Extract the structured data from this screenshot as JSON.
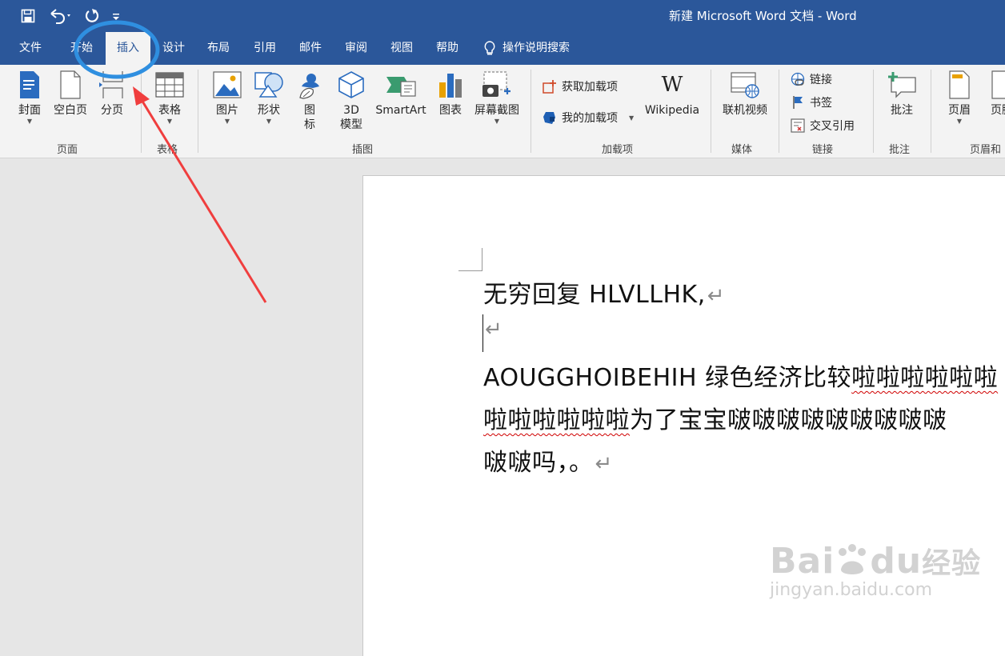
{
  "title_bar": {
    "document_title": "新建 Microsoft Word 文档  -  Word",
    "quick_access": [
      {
        "name": "save-icon"
      },
      {
        "name": "undo-icon"
      },
      {
        "name": "redo-icon"
      },
      {
        "name": "customize-qat-icon"
      }
    ]
  },
  "tabs": [
    {
      "label": "文件"
    },
    {
      "label": "开始"
    },
    {
      "label": "插入",
      "active": true
    },
    {
      "label": "设计"
    },
    {
      "label": "布局"
    },
    {
      "label": "引用"
    },
    {
      "label": "邮件"
    },
    {
      "label": "审阅"
    },
    {
      "label": "视图"
    },
    {
      "label": "帮助"
    }
  ],
  "tell_me": {
    "label": "操作说明搜索",
    "icon": "lightbulb-icon"
  },
  "ribbon": {
    "pages_group": {
      "label": "页面",
      "buttons": [
        {
          "label": "封面",
          "icon": "cover-page-icon",
          "dropdown": true
        },
        {
          "label": "空白页",
          "icon": "blank-page-icon"
        },
        {
          "label": "分页",
          "icon": "page-break-icon"
        }
      ]
    },
    "tables_group": {
      "label": "表格",
      "buttons": [
        {
          "label": "表格",
          "icon": "table-icon",
          "dropdown": true
        }
      ]
    },
    "illustrations_group": {
      "label": "插图",
      "buttons": [
        {
          "label": "图片",
          "icon": "picture-icon",
          "dropdown": true
        },
        {
          "label": "形状",
          "icon": "shapes-icon",
          "dropdown": true
        },
        {
          "label_line1": "图",
          "label_line2": "标",
          "icon": "icons-icon"
        },
        {
          "label_line1": "3D",
          "label_line2": "模型",
          "icon": "3d-model-icon"
        },
        {
          "label": "SmartArt",
          "icon": "smartart-icon"
        },
        {
          "label": "图表",
          "icon": "chart-icon"
        },
        {
          "label": "屏幕截图",
          "icon": "screenshot-icon",
          "dropdown": true
        }
      ]
    },
    "addins_group": {
      "label": "加载项",
      "get_addins": "获取加载项",
      "my_addins": "我的加载项",
      "wikipedia": "Wikipedia",
      "wikipedia_glyph": "W"
    },
    "media_group": {
      "label": "媒体",
      "buttons": [
        {
          "label": "联机视频",
          "icon": "online-video-icon"
        }
      ]
    },
    "links_group": {
      "label": "链接",
      "items": [
        {
          "label": "链接",
          "icon": "link-icon"
        },
        {
          "label": "书签",
          "icon": "bookmark-icon"
        },
        {
          "label": "交叉引用",
          "icon": "cross-reference-icon"
        }
      ]
    },
    "comments_group": {
      "label": "批注",
      "buttons": [
        {
          "label": "批注",
          "icon": "new-comment-icon"
        }
      ]
    },
    "header_footer_group": {
      "label": "页眉和",
      "buttons": [
        {
          "label": "页眉",
          "icon": "header-icon",
          "dropdown": true
        },
        {
          "label": "页脚",
          "icon": "footer-icon"
        }
      ]
    }
  },
  "document": {
    "line1": "无穷回复 HLVLLHK,",
    "line3_plain": "AOUGGHOIBEHIH 绿色经济比较",
    "line3_squiggle": "啦啦啦啦啦啦",
    "line4_squiggle": "啦啦啦啦啦啦",
    "line4_plain": "为了宝宝啵啵啵啵啵啵啵啵啵",
    "line5": "啵啵吗，。",
    "paragraph_mark": "↵"
  },
  "annotations": {
    "highlight_color": "#2f8fe0",
    "arrow_color": "#f03e3e"
  },
  "watermark": {
    "brand": "Bai",
    "brand2": "du",
    "brand_cn": "经验",
    "url": "jingyan.baidu.com"
  },
  "colors": {
    "word_blue": "#2b579a",
    "ribbon_bg": "#f3f3f3"
  }
}
